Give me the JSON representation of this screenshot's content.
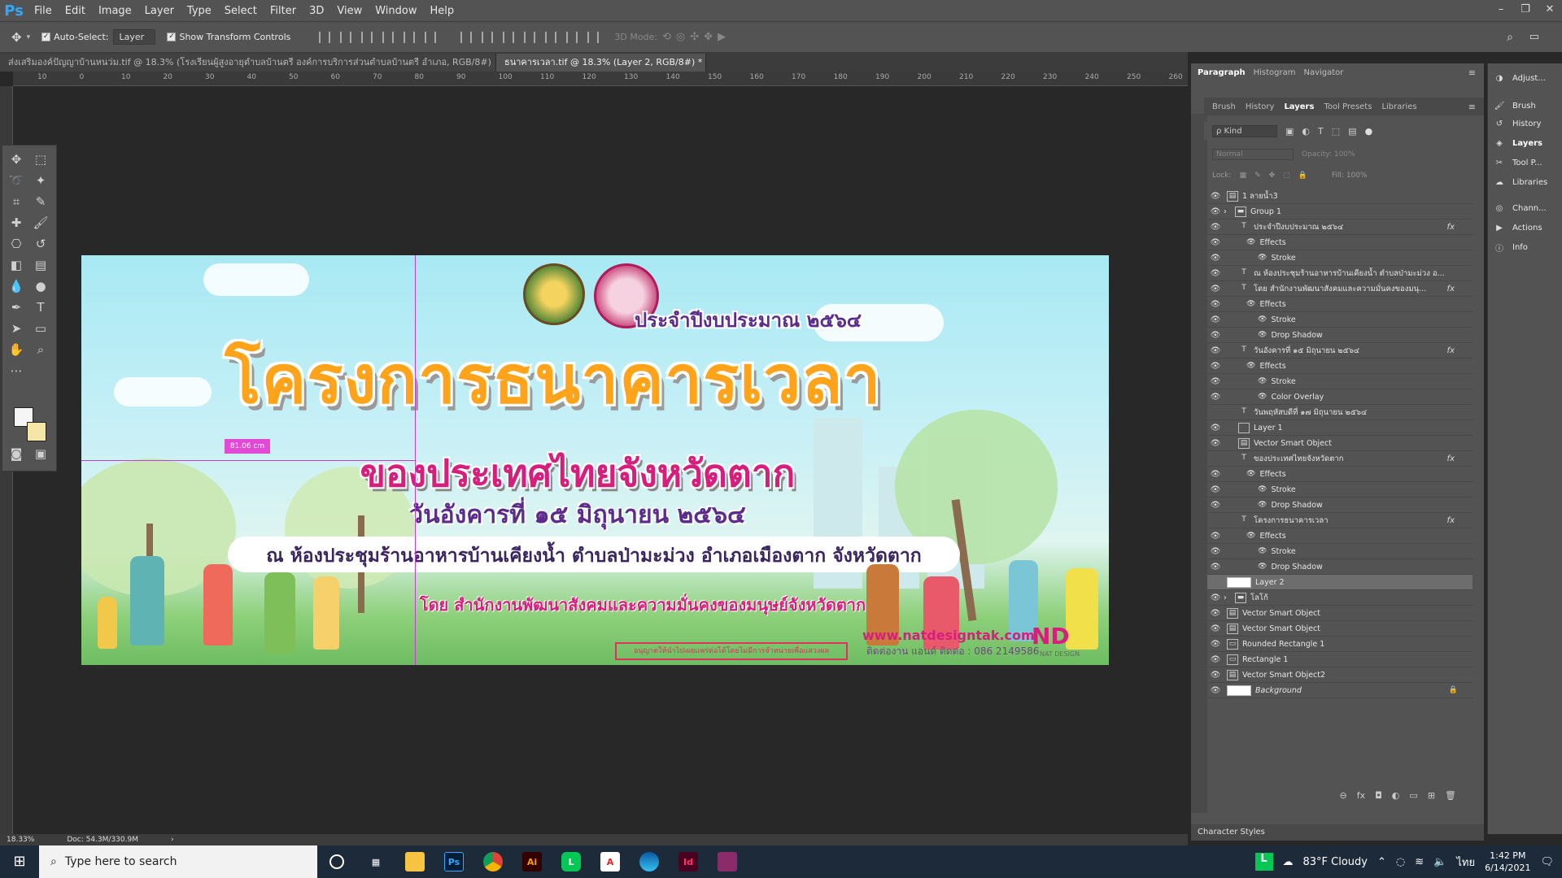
{
  "app": {
    "logo": "Ps"
  },
  "menu": [
    "File",
    "Edit",
    "Image",
    "Layer",
    "Type",
    "Select",
    "Filter",
    "3D",
    "View",
    "Window",
    "Help"
  ],
  "window_controls": [
    "–",
    "❐",
    "✕"
  ],
  "options": {
    "auto_select_label": "Auto-Select:",
    "auto_select_value": "Layer",
    "show_transform_label": "Show Transform Controls",
    "mode3d_label": "3D Mode:"
  },
  "doc_tabs": [
    {
      "label": "ส่งเสริมองค์ปัญญาบ้านหนว่ม.tif @ 18.3% (โรงเรียนผู้สูงอายุตำบลบ้านตรี  องค์การบริการส่วนตำบลบ้านตรี อำเภอ, RGB/8#)",
      "active": false
    },
    {
      "label": "ธนาคารเวลา.tif @ 18.3% (Layer 2, RGB/8#) *",
      "active": true
    }
  ],
  "ruler_ticks": [
    "10",
    "0",
    "10",
    "20",
    "30",
    "40",
    "50",
    "60",
    "70",
    "80",
    "90",
    "100",
    "110",
    "120",
    "130",
    "140",
    "150",
    "160",
    "170",
    "180",
    "190",
    "200",
    "210",
    "220",
    "230",
    "240",
    "250",
    "260"
  ],
  "artwork": {
    "budget_line": "ประจำปีงบประมาณ ๒๕๖๔",
    "title_main": "โครงการธนาคารเวลา",
    "title_sub": "ของประเทศไทยจังหวัดตาก",
    "date_line": "วันอังคารที่ ๑๕ มิถุนายน ๒๕๖๔",
    "place_line": "ณ ห้องประชุมร้านอาหารบ้านเคียงน้ำ ตำบลป่ามะม่วง อำเภอเมืองตาก จังหวัดตาก",
    "org_line": "โดย สำนักงานพัฒนาสังคมและความมั่นคงของมนุษย์จังหวัดตาก",
    "site_url": "www.natdesigntak.com",
    "contact": "ติดต่องาน แอนด์ ติดต่อ : 086 2149586",
    "copyright_note": "อนุญาตให้นำไปเผยแพร่ต่อได้โดยไม่มีการจำหน่ายเพื่อแสวงผล",
    "brand_mark": "ND",
    "brand_label": "NAT DESIGN",
    "measure_label": "81.06 cm"
  },
  "status": {
    "zoom": "18.33%",
    "doc": "Doc: 54.3M/330.9M"
  },
  "panel_tabs": [
    {
      "label": "Paragraph",
      "active": true
    },
    {
      "label": "Histogram",
      "active": false
    },
    {
      "label": "Navigator",
      "active": false
    }
  ],
  "layer_panel_tabs": [
    {
      "label": "Brush",
      "active": false
    },
    {
      "label": "History",
      "active": false
    },
    {
      "label": "Layers",
      "active": true
    },
    {
      "label": "Tool Presets",
      "active": false
    },
    {
      "label": "Libraries",
      "active": false
    }
  ],
  "layers_kind": "ρ Kind",
  "blend_mode": "Normal",
  "opacity_label": "Opacity: 100%",
  "lock_label": "Lock:",
  "fill_label": "Fill: 100%",
  "layers": [
    {
      "name": "1 ลายน้ำ3",
      "visible": true,
      "indent": 0,
      "type": "smart",
      "fx": false
    },
    {
      "name": "Group 1",
      "visible": true,
      "indent": 0,
      "type": "group",
      "fx": false
    },
    {
      "name": "ประจำปีงบประมาณ ๒๕๖๔",
      "visible": true,
      "indent": 1,
      "type": "text",
      "fx": true
    },
    {
      "name": "Effects",
      "visible": true,
      "indent": 2,
      "type": "effect",
      "fx": false
    },
    {
      "name": "Stroke",
      "visible": true,
      "indent": 3,
      "type": "effect",
      "fx": false
    },
    {
      "name": "ณ ห้องประชุมร้านอาหารบ้านเคียงน้ำ ตำบลป่ามะม่วง อ...",
      "visible": true,
      "indent": 1,
      "type": "text",
      "fx": false
    },
    {
      "name": "โดย สำนักงานพัฒนาสังคมและความมั่นคงของมนุ...",
      "visible": true,
      "indent": 1,
      "type": "text",
      "fx": true
    },
    {
      "name": "Effects",
      "visible": true,
      "indent": 2,
      "type": "effect",
      "fx": false
    },
    {
      "name": "Stroke",
      "visible": true,
      "indent": 3,
      "type": "effect",
      "fx": false
    },
    {
      "name": "Drop Shadow",
      "visible": true,
      "indent": 3,
      "type": "effect",
      "fx": false
    },
    {
      "name": "วันอังคารที่ ๑๕ มิถุนายน ๒๕๖๔",
      "visible": true,
      "indent": 1,
      "type": "text",
      "fx": true
    },
    {
      "name": "Effects",
      "visible": true,
      "indent": 2,
      "type": "effect",
      "fx": false
    },
    {
      "name": "Stroke",
      "visible": true,
      "indent": 3,
      "type": "effect",
      "fx": false
    },
    {
      "name": "Color Overlay",
      "visible": true,
      "indent": 3,
      "type": "effect",
      "fx": false
    },
    {
      "name": "วันพฤหัสบดีที่ ๑๗ มิถุนายน ๒๕๖๔",
      "visible": false,
      "indent": 1,
      "type": "text",
      "fx": false
    },
    {
      "name": "Layer 1",
      "visible": true,
      "indent": 1,
      "type": "pixel",
      "fx": false
    },
    {
      "name": "Vector Smart Object",
      "visible": true,
      "indent": 1,
      "type": "smart",
      "fx": false
    },
    {
      "name": "ของประเทศไทยจังหวัดตาก",
      "visible": false,
      "indent": 1,
      "type": "text",
      "fx": true
    },
    {
      "name": "Effects",
      "visible": true,
      "indent": 2,
      "type": "effect",
      "fx": false
    },
    {
      "name": "Stroke",
      "visible": true,
      "indent": 3,
      "type": "effect",
      "fx": false
    },
    {
      "name": "Drop Shadow",
      "visible": true,
      "indent": 3,
      "type": "effect",
      "fx": false
    },
    {
      "name": "โครงการธนาคารเวลา",
      "visible": false,
      "indent": 1,
      "type": "text",
      "fx": true
    },
    {
      "name": "Effects",
      "visible": true,
      "indent": 2,
      "type": "effect",
      "fx": false
    },
    {
      "name": "Stroke",
      "visible": true,
      "indent": 3,
      "type": "effect",
      "fx": false
    },
    {
      "name": "Drop Shadow",
      "visible": true,
      "indent": 3,
      "type": "effect",
      "fx": false
    },
    {
      "name": "Layer 2",
      "visible": false,
      "indent": 0,
      "type": "pixel-big",
      "fx": false,
      "selected": true
    },
    {
      "name": "โลโก้",
      "visible": true,
      "indent": 0,
      "type": "group",
      "fx": false
    },
    {
      "name": "Vector Smart Object",
      "visible": true,
      "indent": 0,
      "type": "smart",
      "fx": false
    },
    {
      "name": "Vector Smart Object",
      "visible": true,
      "indent": 0,
      "type": "smart",
      "fx": false
    },
    {
      "name": "Rounded Rectangle 1",
      "visible": true,
      "indent": 0,
      "type": "shape",
      "fx": false
    },
    {
      "name": "Rectangle 1",
      "visible": true,
      "indent": 0,
      "type": "shape",
      "fx": false
    },
    {
      "name": "Vector Smart Object2",
      "visible": true,
      "indent": 0,
      "type": "smart",
      "fx": false
    },
    {
      "name": "Background",
      "visible": true,
      "indent": 0,
      "type": "background",
      "fx": false,
      "locked": true
    }
  ],
  "layers_footer": [
    "⊖",
    "fx",
    "◘",
    "◐",
    "▭",
    "⊞",
    "🗑"
  ],
  "character_styles": "Character Styles",
  "dock": [
    {
      "label": "Adjust...",
      "icon": "adjust-icon"
    },
    {
      "label": "Brush",
      "icon": "brush-icon"
    },
    {
      "label": "History",
      "icon": "history-icon"
    },
    {
      "label": "Layers",
      "icon": "layers-icon",
      "active": true
    },
    {
      "label": "Tool P...",
      "icon": "tool-presets-icon"
    },
    {
      "label": "Libraries",
      "icon": "libraries-icon"
    },
    {
      "label": "Chann...",
      "icon": "channels-icon"
    },
    {
      "label": "Actions",
      "icon": "actions-icon"
    },
    {
      "label": "Info",
      "icon": "info-icon"
    }
  ],
  "taskbar": {
    "search_placeholder": "Type here to search",
    "weather": "83°F  Cloudy",
    "lang": "ไทย",
    "time": "1:42 PM",
    "date": "6/14/2021"
  },
  "colors": {
    "ps_blue": "#31a8ff",
    "title_orange": "#ffa31a",
    "magenta": "#d61f7c",
    "purple": "#5b2c8a"
  }
}
